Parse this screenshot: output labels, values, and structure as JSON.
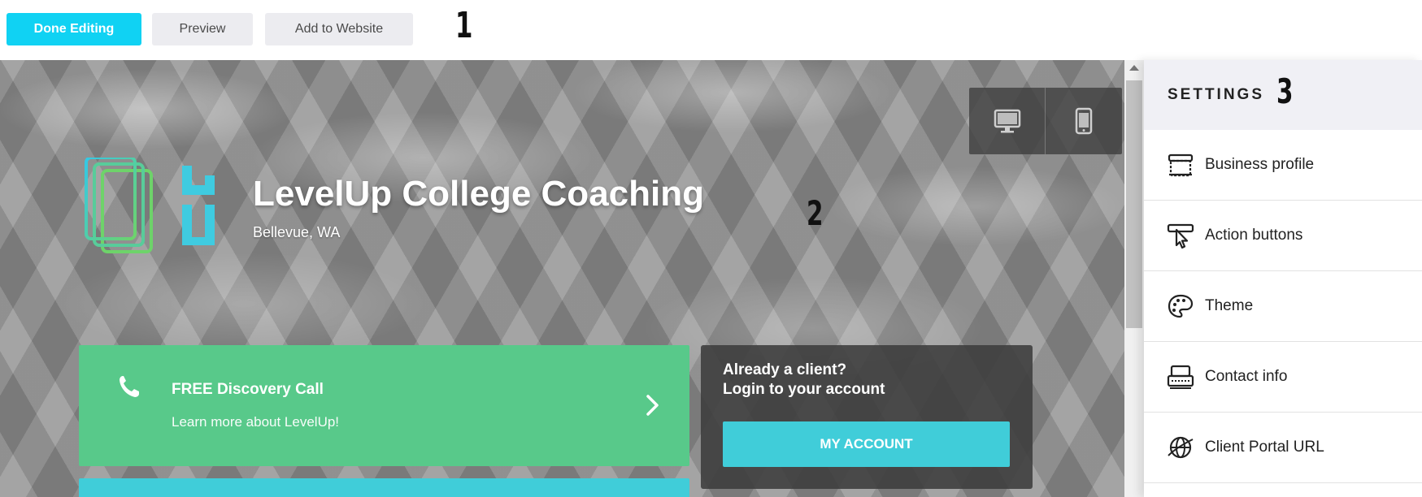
{
  "toolbar": {
    "done_label": "Done Editing",
    "preview_label": "Preview",
    "add_label": "Add to Website",
    "accent": "#10d2f3"
  },
  "markers": {
    "m1": "1",
    "m2": "2",
    "m3": "3"
  },
  "preview": {
    "device_toggle": [
      "desktop-icon",
      "mobile-icon"
    ],
    "logo": "levelup-logo",
    "business_name": "LevelUp College Coaching",
    "location": "Bellevue, WA",
    "cta": {
      "icon": "phone-icon",
      "title": "FREE Discovery Call",
      "subtitle": "Learn more about LevelUp!",
      "color": "#58c98a"
    },
    "client": {
      "line1": "Already a client?",
      "line2": "Login to your account",
      "button": "MY ACCOUNT",
      "button_color": "#40cdd9"
    }
  },
  "settings": {
    "title": "SETTINGS",
    "items": [
      {
        "label": "Business profile",
        "icon": "storefront-icon"
      },
      {
        "label": "Action buttons",
        "icon": "pointer-click-icon"
      },
      {
        "label": "Theme",
        "icon": "palette-icon"
      },
      {
        "label": "Contact info",
        "icon": "contact-card-icon"
      },
      {
        "label": "Client Portal URL",
        "icon": "globe-icon"
      }
    ]
  }
}
